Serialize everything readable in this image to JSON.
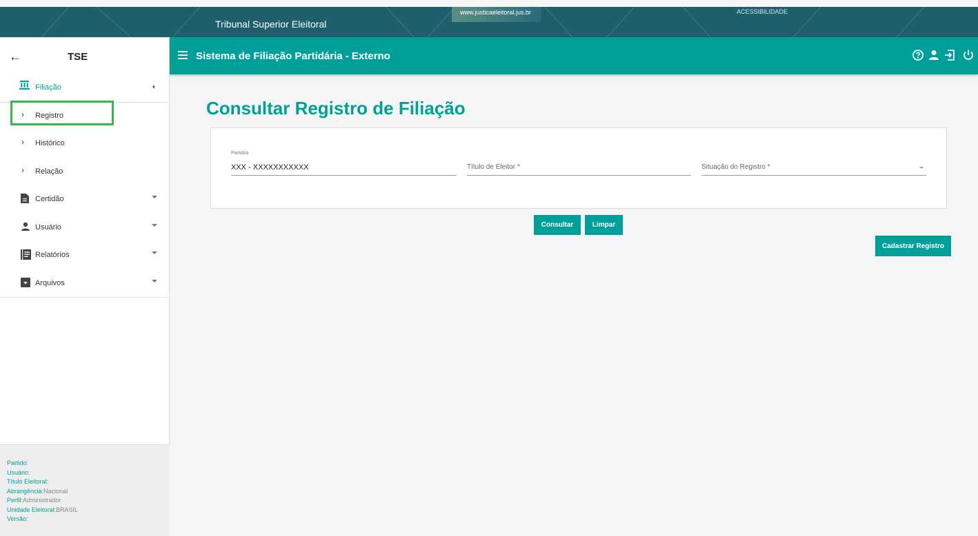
{
  "govbar": {
    "title": "Tribunal Superior Eleitoral",
    "link": "www.justicaeleitoral.jus.br",
    "accessibility": "ACESSIBILIDADE"
  },
  "sidebar": {
    "back_icon": "arrow-left-icon",
    "title": "TSE",
    "items": [
      {
        "label": "Filiação",
        "icon": "bank-icon",
        "active": true
      },
      {
        "label": "Registro",
        "icon": "chevron-right-icon"
      },
      {
        "label": "Histórico",
        "icon": "chevron-right-icon"
      },
      {
        "label": "Relação",
        "icon": "chevron-right-icon"
      },
      {
        "label": "Certidão",
        "icon": "document-icon"
      },
      {
        "label": "Usuário",
        "icon": "person-icon"
      },
      {
        "label": "Relatórios",
        "icon": "report-icon"
      },
      {
        "label": "Arquivos",
        "icon": "archive-icon"
      }
    ],
    "footer": {
      "partido_label": "Partido:",
      "usuario_label": "Usuário:",
      "titulo_label": "Título Eleitoral:",
      "abrangencia_label": "Abrangência:",
      "abrangencia_value": "Nacional",
      "perfil_label": "Perfil:",
      "perfil_value": "Administrador",
      "unidade_label": "Unidade Eleitoral:",
      "unidade_value": "BRASIL",
      "versao_label": "Versão:"
    }
  },
  "header": {
    "title": "Sistema de Filiação Partidária - Externo",
    "icons": [
      "help-icon",
      "user-icon",
      "login-icon",
      "power-icon"
    ]
  },
  "main": {
    "page_title": "Consultar Registro de Filiação",
    "form": {
      "partidos_label": "Partidos",
      "partidos_value": "XXX - XXXXXXXXXXX",
      "titulo_placeholder": "Título de Eleitor *",
      "situacao_placeholder": "Situação do Registro *"
    },
    "buttons": {
      "consultar": "Consultar",
      "limpar": "Limpar",
      "cadastrar": "Cadastrar Registro"
    }
  },
  "colors": {
    "accent": "#00a09a",
    "govbar": "#1e5f6b",
    "highlight": "#3cb54a"
  }
}
